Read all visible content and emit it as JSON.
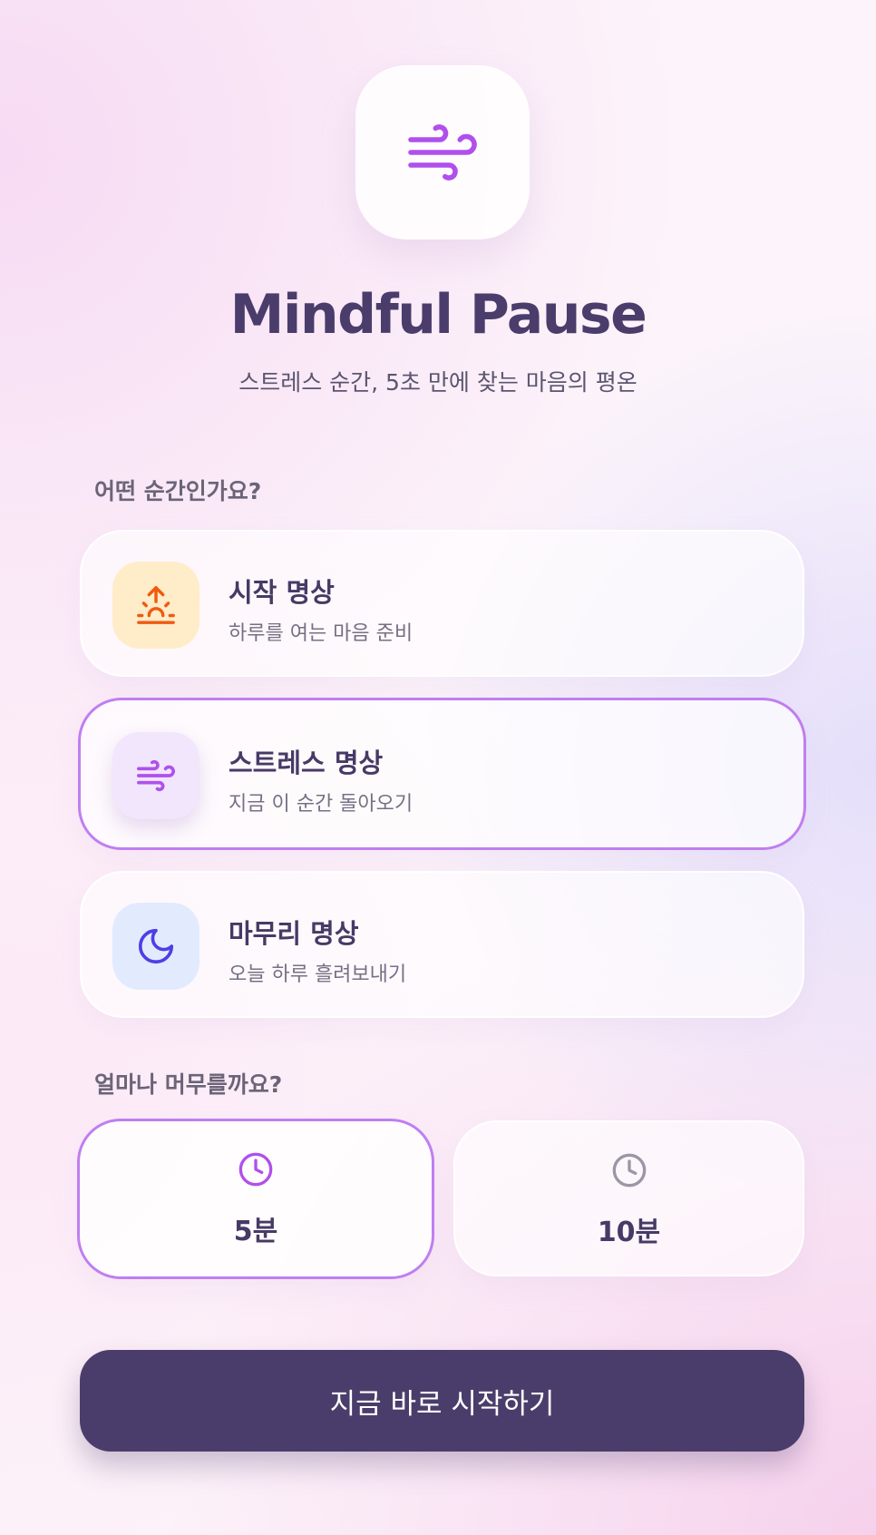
{
  "app": {
    "title": "Mindful Pause",
    "subtitle": "스트레스 순간, 5초 만에 찾는 마음의 평온"
  },
  "moment_section": {
    "label": "어떤 순간인가요?",
    "options": [
      {
        "title": "시작 명상",
        "description": "하루를 여는 마음 준비",
        "icon": "sunrise-icon",
        "selected": false
      },
      {
        "title": "스트레스 명상",
        "description": "지금 이 순간 돌아오기",
        "icon": "wind-icon",
        "selected": true
      },
      {
        "title": "마무리 명상",
        "description": "오늘 하루 흘려보내기",
        "icon": "moon-icon",
        "selected": false
      }
    ]
  },
  "duration_section": {
    "label": "얼마나 머무를까요?",
    "options": [
      {
        "label": "5분",
        "icon": "clock-icon",
        "selected": true
      },
      {
        "label": "10분",
        "icon": "clock-icon",
        "selected": false
      }
    ]
  },
  "start_button": {
    "label": "지금 바로 시작하기"
  },
  "colors": {
    "accent": "#c07ef0",
    "primary_dark": "#4b3d6b",
    "wind_icon": "#b050ec",
    "sunrise_icon": "#f05a10",
    "moon_icon": "#4e3ee6"
  }
}
